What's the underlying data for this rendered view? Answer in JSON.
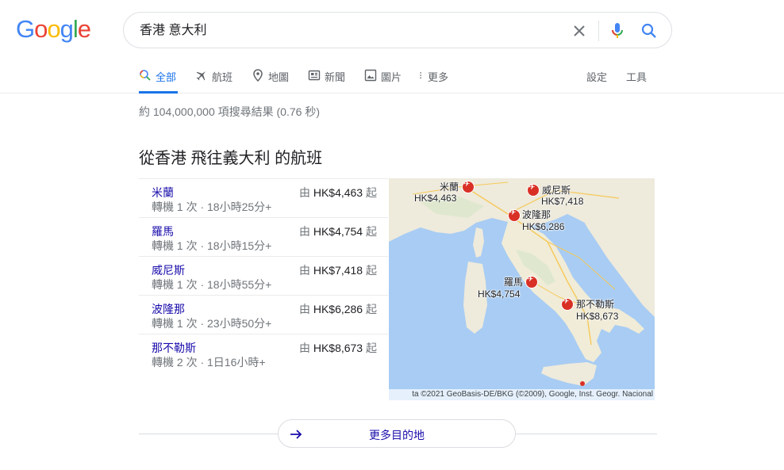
{
  "logo": {
    "letters": [
      "G",
      "o",
      "o",
      "g",
      "l",
      "e"
    ],
    "colors": [
      "#4285f4",
      "#ea4335",
      "#fbbc05",
      "#4285f4",
      "#34a853",
      "#ea4335"
    ]
  },
  "search": {
    "query": "香港 意大利",
    "icons": [
      "close-icon",
      "mic-icon",
      "search-icon"
    ]
  },
  "tabs": [
    {
      "label": "全部",
      "icon": "search-icon",
      "active": true
    },
    {
      "label": "航班",
      "icon": "plane-icon"
    },
    {
      "label": "地圖",
      "icon": "map-pin-icon"
    },
    {
      "label": "新聞",
      "icon": "news-icon"
    },
    {
      "label": "圖片",
      "icon": "image-icon"
    },
    {
      "label": "更多",
      "icon": "more-vert-icon"
    },
    {
      "label": "設定"
    },
    {
      "label": "工具"
    }
  ],
  "stats": "約 104,000,000 項搜尋結果 (0.76 秒)",
  "heading": "從香港 飛往義大利 的航班",
  "flights": [
    {
      "dest": "米蘭",
      "meta": "轉機 1 次 · 18小時25分+",
      "from": "由",
      "price": "HK$4,463",
      "suffix": "起"
    },
    {
      "dest": "羅馬",
      "meta": "轉機 1 次 · 18小時15分+",
      "from": "由",
      "price": "HK$4,754",
      "suffix": "起"
    },
    {
      "dest": "威尼斯",
      "meta": "轉機 1 次 · 18小時55分+",
      "from": "由",
      "price": "HK$7,418",
      "suffix": "起"
    },
    {
      "dest": "波隆那",
      "meta": "轉機 1 次 · 23小時50分+",
      "from": "由",
      "price": "HK$6,286",
      "suffix": "起"
    },
    {
      "dest": "那不勒斯",
      "meta": "轉機 2 次 · 1日16小時+",
      "from": "由",
      "price": "HK$8,673",
      "suffix": "起"
    }
  ],
  "map": {
    "markers": [
      {
        "city": "米蘭",
        "price": "HK$4,463"
      },
      {
        "city": "威尼斯",
        "price": "HK$7,418"
      },
      {
        "city": "波隆那",
        "price": "HK$6,286"
      },
      {
        "city": "羅馬",
        "price": "HK$4,754"
      },
      {
        "city": "那不勒斯",
        "price": "HK$8,673"
      }
    ],
    "attribution": "ta ©2021 GeoBasis-DE/BKG (©2009), Google, Inst. Geogr. Nacional"
  },
  "more": {
    "label": "更多目的地",
    "icon": "arrow-right-icon"
  }
}
